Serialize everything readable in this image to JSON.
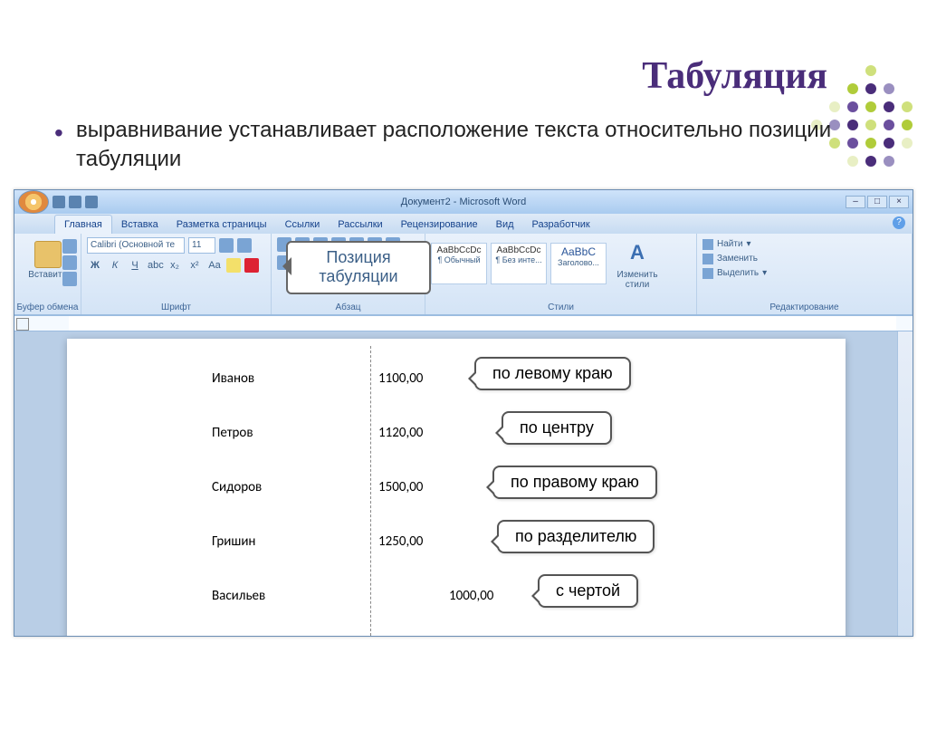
{
  "slide": {
    "title": "Табуляция",
    "bullet": "выравнивание устанавливает расположение текста относительно позиции табуляции"
  },
  "word": {
    "title": "Документ2 - Microsoft Word",
    "tabs": [
      "Главная",
      "Вставка",
      "Разметка страницы",
      "Ссылки",
      "Рассылки",
      "Рецензирование",
      "Вид",
      "Разработчик"
    ],
    "ribbon": {
      "clipboard": {
        "paste": "Вставить",
        "label": "Буфер обмена"
      },
      "font": {
        "name": "Calibri (Основной те",
        "size": "11",
        "buttons": [
          "Ж",
          "К",
          "Ч",
          "·",
          "abc",
          "x₂",
          "x²",
          "Aa"
        ],
        "label": "Шрифт"
      },
      "paragraph": {
        "label": "Абзац"
      },
      "styles": {
        "tiles": [
          {
            "preview": "AaBbCcDc",
            "name": "¶ Обычный"
          },
          {
            "preview": "AaBbCcDc",
            "name": "¶ Без инте..."
          },
          {
            "preview": "AaBbC",
            "name": "Заголово..."
          }
        ],
        "change": "Изменить стили",
        "label": "Стили"
      },
      "editing": {
        "find": "Найти",
        "replace": "Заменить",
        "select": "Выделить",
        "label": "Редактирование"
      }
    }
  },
  "callouts": {
    "tab_position": "Позиция табуляции",
    "left": "по левому краю",
    "center": "по центру",
    "right": "по правому краю",
    "decimal": "по разделителю",
    "bar": "с чертой"
  },
  "document": {
    "rows": [
      {
        "name": "Иванов",
        "value": "1100,00"
      },
      {
        "name": "Петров",
        "value": "1120,00"
      },
      {
        "name": "Сидоров",
        "value": "1500,00"
      },
      {
        "name": "Гришин",
        "value": "1250,00"
      },
      {
        "name": "Васильев",
        "value": "1000,00"
      }
    ]
  }
}
